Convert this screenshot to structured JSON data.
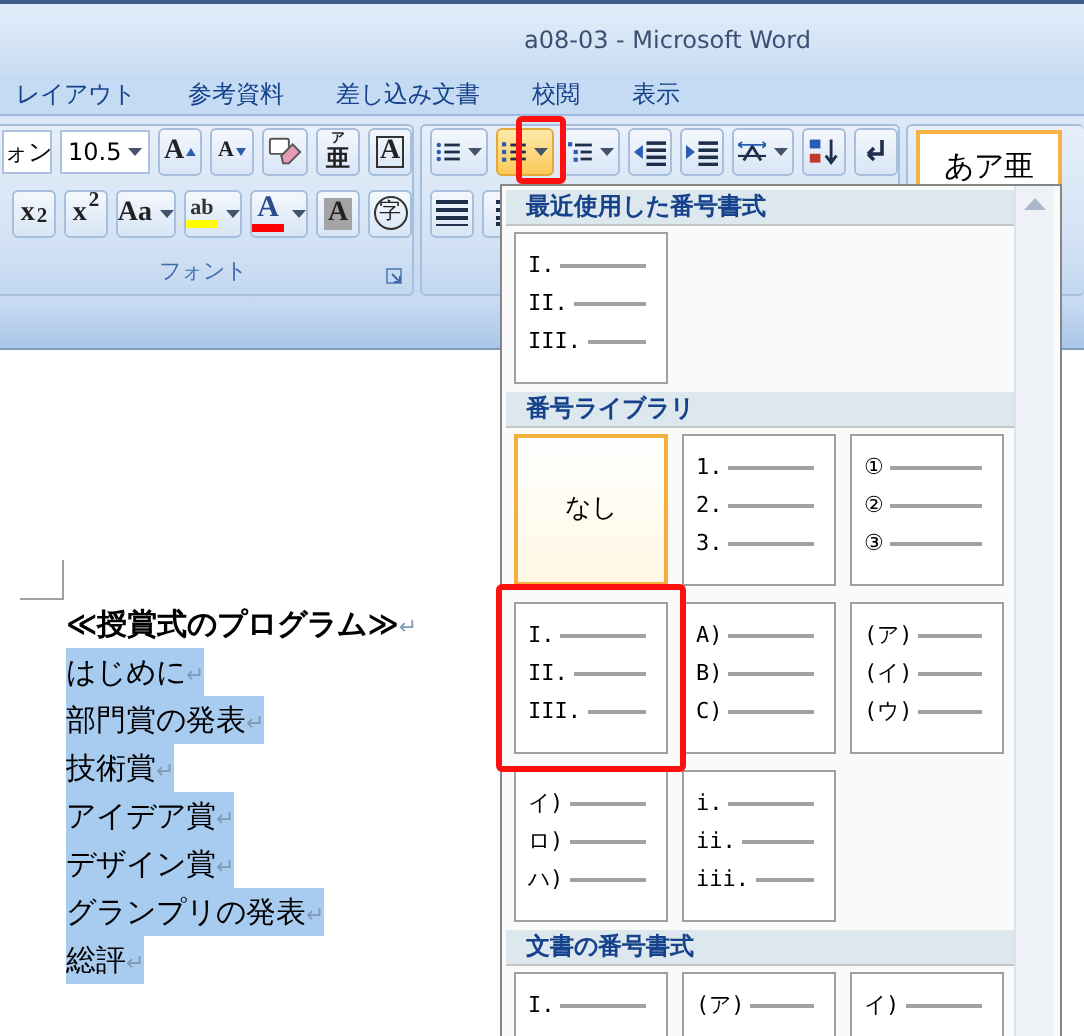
{
  "window": {
    "title": "a08-03 - Microsoft Word"
  },
  "ribbon_tabs": [
    "レイアウト",
    "参考資料",
    "差し込み文書",
    "校閲",
    "表示"
  ],
  "font_group": {
    "font_name": "ォン",
    "font_size": "10.5",
    "label": "フォント",
    "row1": [
      {
        "kind": "grow",
        "glyph": "A"
      },
      {
        "kind": "shrink",
        "glyph": "A"
      },
      {
        "kind": "clear"
      },
      {
        "kind": "ruby",
        "glyph": "亜",
        "ruby": "ア"
      },
      {
        "kind": "border",
        "glyph": "A"
      }
    ],
    "row2": [
      {
        "kind": "subscript",
        "glyph": "x$_{2}$"
      },
      {
        "kind": "superscript",
        "glyph": "x$^{2}$"
      },
      {
        "kind": "case",
        "glyph": "Aa",
        "dropdown": true
      },
      {
        "kind": "highlight",
        "glyph": "ab",
        "color": "#ffff00",
        "dropdown": true
      },
      {
        "kind": "font-color",
        "glyph": "A",
        "color": "#ff0000",
        "dropdown": true
      },
      {
        "kind": "shading",
        "glyph": "A"
      },
      {
        "kind": "enclose",
        "glyph": "字"
      }
    ]
  },
  "paragraph_group": {
    "row1": [
      {
        "kind": "bullets",
        "dropdown": true,
        "active": false,
        "annotated": false
      },
      {
        "kind": "numbering",
        "dropdown": true,
        "active": true,
        "annotated": true
      },
      {
        "kind": "multilevel",
        "dropdown": true,
        "active": false,
        "annotated": false
      },
      {
        "kind": "outdent",
        "dropdown": false,
        "active": false,
        "annotated": false
      },
      {
        "kind": "indent",
        "dropdown": false,
        "active": false,
        "annotated": false
      },
      {
        "kind": "distribute",
        "dropdown": true,
        "active": false,
        "annotated": false
      },
      {
        "kind": "sort",
        "dropdown": false,
        "active": false,
        "annotated": false
      },
      {
        "kind": "marks",
        "dropdown": false,
        "active": false,
        "annotated": false
      }
    ],
    "row2": [
      {
        "kind": "align-left",
        "dropdown": false,
        "active": false,
        "annotated": false
      },
      {
        "kind": "align-center",
        "dropdown": false,
        "active": false,
        "annotated": false
      }
    ]
  },
  "styles": {
    "preview": "あア亜"
  },
  "numbering_menu": {
    "sections": [
      {
        "title": "最近使用した番号書式",
        "tiles": [
          {
            "kind": "list",
            "labels": [
              "I.",
              "II.",
              "III."
            ],
            "selected": false,
            "annotated": false
          }
        ]
      },
      {
        "title": "番号ライブラリ",
        "tiles": [
          {
            "kind": "none",
            "text": "なし",
            "selected": true,
            "annotated": false
          },
          {
            "kind": "list",
            "labels": [
              "1.",
              "2.",
              "3."
            ],
            "selected": false,
            "annotated": false
          },
          {
            "kind": "list",
            "labels": [
              "①",
              "②",
              "③"
            ],
            "selected": false,
            "annotated": false
          },
          {
            "kind": "list",
            "labels": [
              "I.",
              "II.",
              "III."
            ],
            "selected": false,
            "annotated": true
          },
          {
            "kind": "list",
            "labels": [
              "A)",
              "B)",
              "C)"
            ],
            "selected": false,
            "annotated": false
          },
          {
            "kind": "list",
            "labels": [
              "(ア)",
              "(イ)",
              "(ウ)"
            ],
            "selected": false,
            "annotated": false
          },
          {
            "kind": "list",
            "labels": [
              "イ)",
              "ロ)",
              "ハ)"
            ],
            "selected": false,
            "annotated": false
          },
          {
            "kind": "list",
            "labels": [
              "i.",
              "ii.",
              "iii."
            ],
            "selected": false,
            "annotated": false
          }
        ]
      },
      {
        "title": "文書の番号書式",
        "tiles": [
          {
            "kind": "list",
            "labels": [
              "I."
            ],
            "selected": false,
            "annotated": false
          },
          {
            "kind": "list",
            "labels": [
              "(ア)"
            ],
            "selected": false,
            "annotated": false
          },
          {
            "kind": "list",
            "labels": [
              "イ)"
            ],
            "selected": false,
            "annotated": false
          }
        ]
      }
    ]
  },
  "document": {
    "lines": [
      {
        "text": "≪授賞式のプログラム≫",
        "end_mark": "↵",
        "bold": true,
        "selected": false
      },
      {
        "text": "はじめに",
        "end_mark": "↵",
        "bold": false,
        "selected": true
      },
      {
        "text": "部門賞の発表",
        "end_mark": "↵",
        "bold": false,
        "selected": true
      },
      {
        "text": "技術賞",
        "end_mark": "↵",
        "bold": false,
        "selected": true
      },
      {
        "text": "アイデア賞",
        "end_mark": "↵",
        "bold": false,
        "selected": true
      },
      {
        "text": "デザイン賞",
        "end_mark": "↵",
        "bold": false,
        "selected": true
      },
      {
        "text": "グランプリの発表",
        "end_mark": "↵",
        "bold": false,
        "selected": true
      },
      {
        "text": "総評",
        "end_mark": "↵",
        "bold": false,
        "selected": true
      }
    ]
  }
}
